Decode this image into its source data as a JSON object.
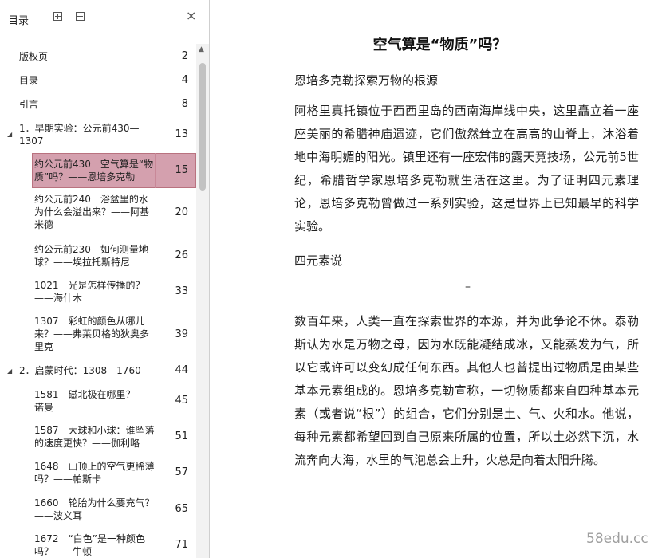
{
  "sidebar": {
    "title": "目录",
    "expand_all_icon": "expand-all-icon",
    "collapse_all_icon": "collapse-all-icon",
    "close_label": "×",
    "items": [
      {
        "label": "版权页",
        "page": "2"
      },
      {
        "label": "目录",
        "page": "4"
      },
      {
        "label": "引言",
        "page": "8"
      },
      {
        "label": "1．早期实验：公元前430—1307",
        "page": "13"
      },
      {
        "label": "约公元前430　空气算是“物质”吗？——恩培多克勒",
        "page": "15"
      },
      {
        "label": "约公元前240　浴盆里的水为什么会溢出来？——阿基米德",
        "page": "20"
      },
      {
        "label": "约公元前230　如何测量地球？——埃拉托斯特尼",
        "page": "26"
      },
      {
        "label": "1021　光是怎样传播的？——海什木",
        "page": "33"
      },
      {
        "label": "1307　彩虹的颜色从哪儿来？——弗莱贝格的狄奥多里克",
        "page": "39"
      },
      {
        "label": "2．启蒙时代：1308—1760",
        "page": "44"
      },
      {
        "label": "1581　磁北极在哪里？——诺曼",
        "page": "45"
      },
      {
        "label": "1587　大球和小球：谁坠落的速度更快？——伽利略",
        "page": "51"
      },
      {
        "label": "1648　山顶上的空气更稀薄吗？——帕斯卡",
        "page": "57"
      },
      {
        "label": "1660　轮胎为什么要充气？——波义耳",
        "page": "65"
      },
      {
        "label": "1672　“白色”是一种颜色吗？——牛顿",
        "page": "71"
      }
    ]
  },
  "document": {
    "title": "空气算是“物质”吗？",
    "heading1": "恩培多克勒探索万物的根源",
    "para1": "阿格里真托镇位于西西里岛的西南海岸线中央，这里矗立着一座座美丽的希腊神庙遗迹，它们傲然耸立在高高的山脊上，沐浴着地中海明媚的阳光。镇里还有一座宏伟的露天竞技场，公元前5世纪，希腊哲学家恩培多克勒就生活在这里。为了证明四元素理论，恩培多克勒曾做过一系列实验，这是世界上已知最早的科学实验。",
    "heading2": "四元素说",
    "divider": "–",
    "para2": "数百年来，人类一直在探索世界的本源，并为此争论不休。泰勒斯认为水是万物之母，因为水既能凝结成冰，又能蒸发为气，所以它或许可以变幻成任何东西。其他人也曾提出过物质是由某些基本元素组成的。恩培多克勒宣称，一切物质都来自四种基本元素（或者说“根”）的组合，它们分别是土、气、火和水。他说，每种元素都希望回到自己原来所属的位置，所以土必然下沉，水流奔向大海，水里的气泡总会上升，火总是向着太阳升腾。"
  },
  "watermark": "58edu.cc"
}
